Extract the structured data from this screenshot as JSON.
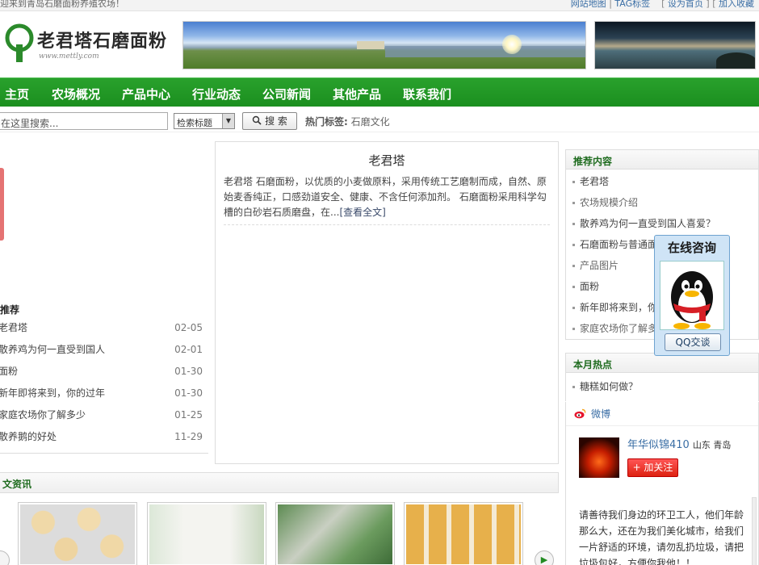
{
  "topbar": {
    "welcome": "迎来到青岛石磨面粉养殖农场！",
    "sitemap": "网站地图",
    "sep1": "|",
    "tags": "TAG标签",
    "set_home": "设为首页",
    "bookmark": "加入收藏"
  },
  "logo": {
    "brand": "老君塔石磨面粉",
    "url": "www.mettly.com"
  },
  "nav": {
    "items": [
      "主页",
      "农场概况",
      "产品中心",
      "行业动态",
      "公司新闻",
      "其他产品",
      "联系我们"
    ]
  },
  "search": {
    "placeholder": "在这里搜索...",
    "select_value": "检索标题",
    "button": "搜 索",
    "hot_label": "热门标签:",
    "hot_tag": "石磨文化"
  },
  "left": {
    "heading": "推荐",
    "items": [
      {
        "title": "老君塔",
        "date": "02-05"
      },
      {
        "title": "散养鸡为何一直受到国人",
        "date": "02-01"
      },
      {
        "title": "面粉",
        "date": "01-30"
      },
      {
        "title": "新年即将来到，你的过年",
        "date": "01-30"
      },
      {
        "title": "家庭农场你了解多少",
        "date": "01-25"
      },
      {
        "title": "散养鹅的好处",
        "date": "11-29"
      }
    ]
  },
  "article": {
    "title": "老君塔",
    "summary": "老君塔 石磨面粉，以优质的小麦做原料，采用传统工艺磨制而成，自然、原始麦香纯正，口感劲道安全、健康、不含任何添加剂。 石磨面粉采用科学勾槽的白砂岩石质磨盘，在...",
    "more": "[查看全文]"
  },
  "recommend": {
    "heading": "推荐内容",
    "items": [
      "老君塔",
      "农场规模介绍",
      "散养鸡为何一直受到国人喜爱？",
      "石磨面粉与普通面",
      "产品图片",
      "面粉",
      "新年即将来到，你",
      "家庭农场你了解多"
    ]
  },
  "hot": {
    "heading": "本月热点",
    "items": [
      "糖糕如何做？"
    ]
  },
  "weibo": {
    "label": "微博",
    "user": "年华似锦410",
    "location": "山东 青岛",
    "follow": "+ 加关注",
    "post": "请善待我们身边的环卫工人，他们年龄那么大，还在为我们美化城市，给我们一片舒适的环境，请勿乱扔垃圾，请把垃圾包好，方便你我他！！ http://t.cn/R"
  },
  "qq": {
    "title": "在线咨询",
    "button": "QQ交谈"
  },
  "news": {
    "heading": "文资讯"
  },
  "colors": {
    "nav_green": "#1b8f1f",
    "heading_green": "#1e6b1e",
    "link_blue": "#3a6ea5",
    "follow_red": "#dd2211"
  }
}
